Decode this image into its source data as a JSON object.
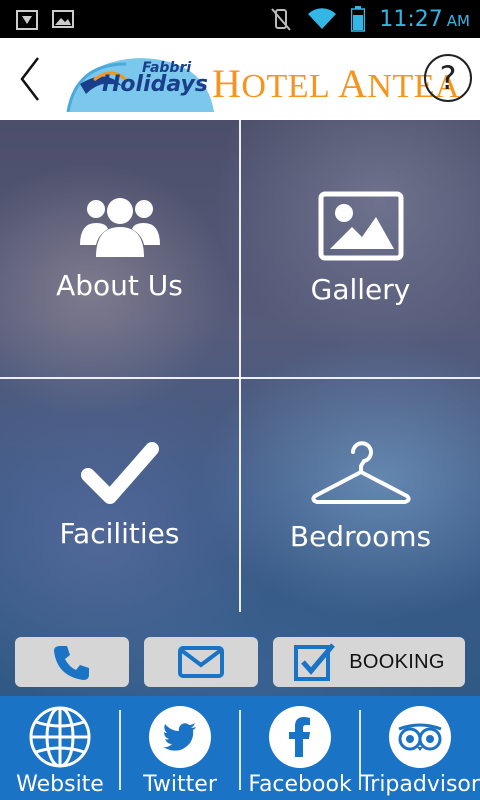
{
  "status_bar": {
    "time": "11:27",
    "ampm": "AM",
    "icons": [
      "usb-debug-icon",
      "image-notification-icon",
      "vibrate-mute-icon",
      "wifi-icon",
      "battery-icon"
    ],
    "accent_color": "#33b5e5"
  },
  "header": {
    "logo_brand_line1": "Fabbri",
    "logo_brand_line2": "Holidays",
    "hotel_name_prefix_big": "H",
    "hotel_name_prefix": "OTEL ",
    "hotel_name_big2": "A",
    "hotel_name_rest": "NTEA",
    "help_label": "?",
    "hotel_color": "#f7941d"
  },
  "tiles": {
    "about": {
      "label": "About Us",
      "icon": "people-icon"
    },
    "gallery": {
      "label": "Gallery",
      "icon": "picture-icon"
    },
    "facilities": {
      "label": "Facilities",
      "icon": "checkmark-icon"
    },
    "bedrooms": {
      "label": "Bedrooms",
      "icon": "hanger-icon"
    }
  },
  "actions": {
    "booking_label": "BOOKING",
    "accent_color": "#1a73c4"
  },
  "social": {
    "website": "Website",
    "twitter": "Twitter",
    "facebook": "Facebook",
    "tripadvisor": "Tripadvisor",
    "bar_color": "#1a73c4"
  }
}
